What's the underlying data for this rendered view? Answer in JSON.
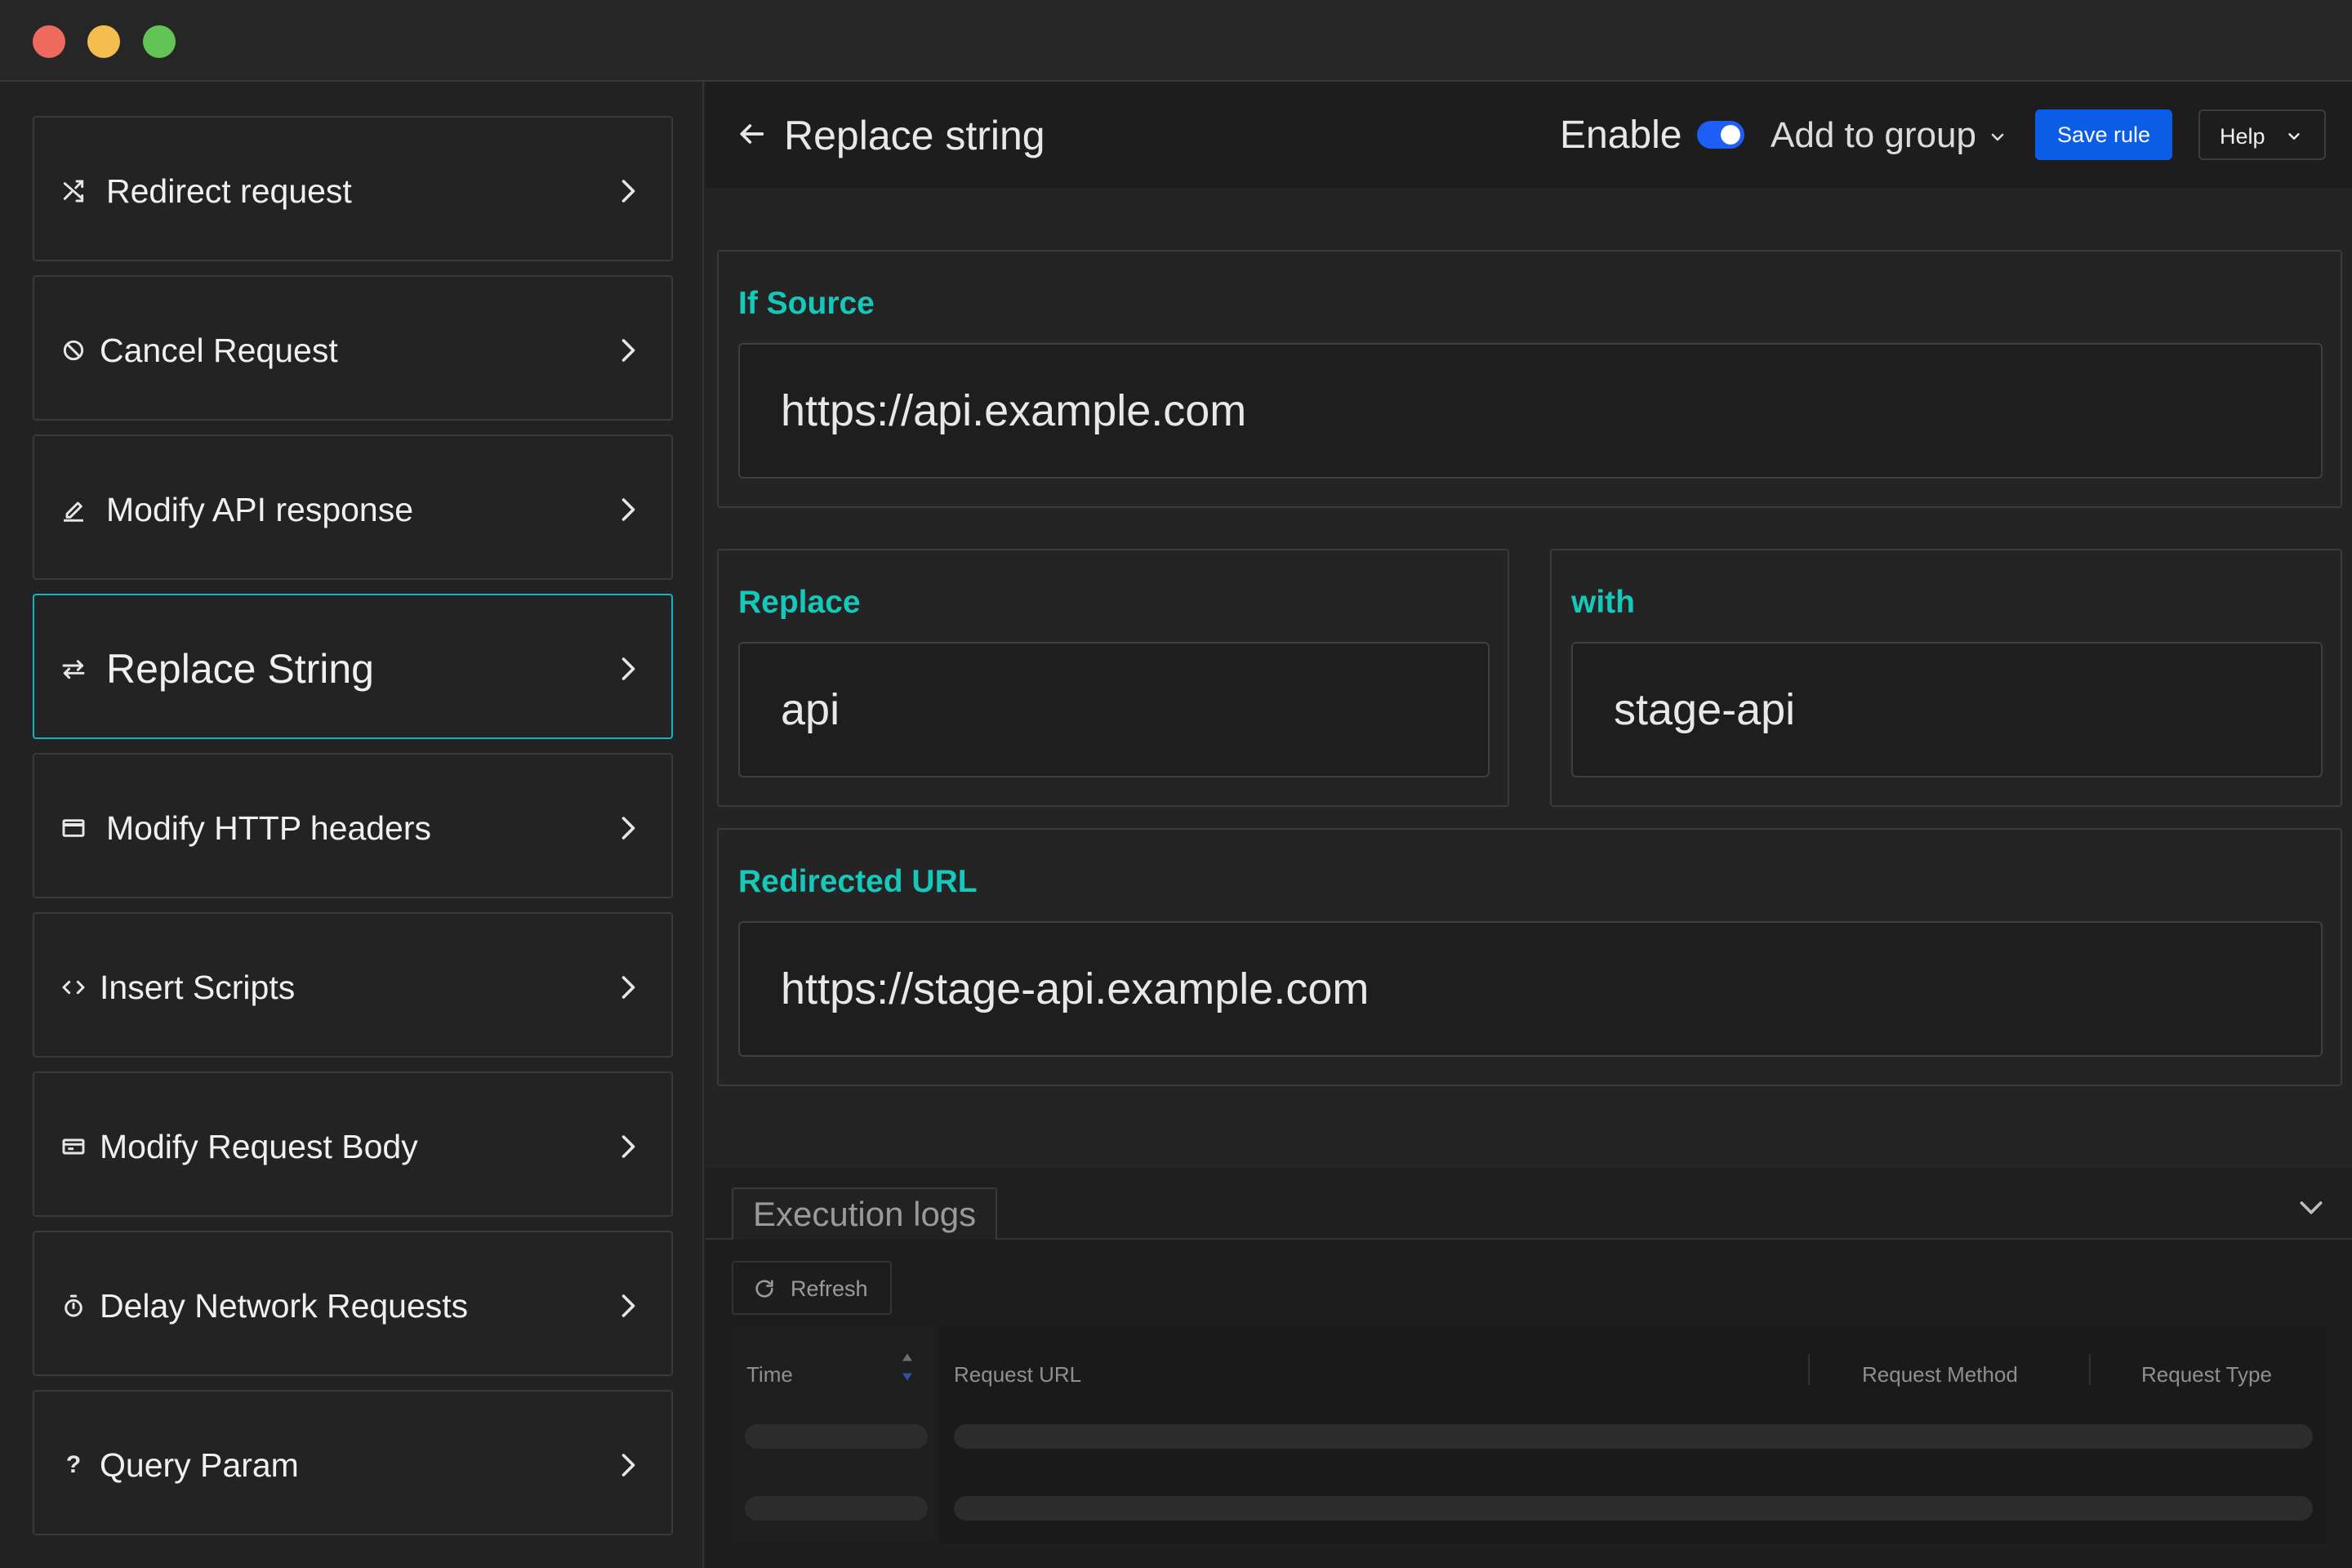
{
  "sidebar": {
    "items": [
      {
        "label": "Redirect request",
        "icon": "shuffle-icon"
      },
      {
        "label": "Cancel Request",
        "icon": "block-icon"
      },
      {
        "label": "Modify API response",
        "icon": "edit-icon"
      },
      {
        "label": "Replace String",
        "icon": "swap-icon",
        "active": true
      },
      {
        "label": "Modify HTTP headers",
        "icon": "window-icon"
      },
      {
        "label": "Insert Scripts",
        "icon": "code-icon"
      },
      {
        "label": "Modify Request Body",
        "icon": "request-body-icon"
      },
      {
        "label": "Delay Network Requests",
        "icon": "timer-icon"
      },
      {
        "label": "Query Param",
        "icon": "question-icon"
      }
    ]
  },
  "header": {
    "title": "Replace string",
    "enable_label": "Enable",
    "enabled": true,
    "group_label": "Add to group",
    "save_label": "Save rule",
    "help_label": "Help"
  },
  "rule": {
    "source_label": "If Source",
    "source_value": "https://api.example.com",
    "replace_label": "Replace",
    "replace_value": "api",
    "with_label": "with",
    "with_value": "stage-api",
    "redirect_label": "Redirected URL",
    "redirect_value": "https://stage-api.example.com"
  },
  "logs": {
    "tab_label": "Execution logs",
    "refresh_label": "Refresh",
    "columns": [
      "Time",
      "Request URL",
      "Request Method",
      "Request Type"
    ]
  },
  "colors": {
    "accent": "#16c8b9",
    "primary": "#0b5ce6",
    "active_border": "#0fb3c4"
  }
}
